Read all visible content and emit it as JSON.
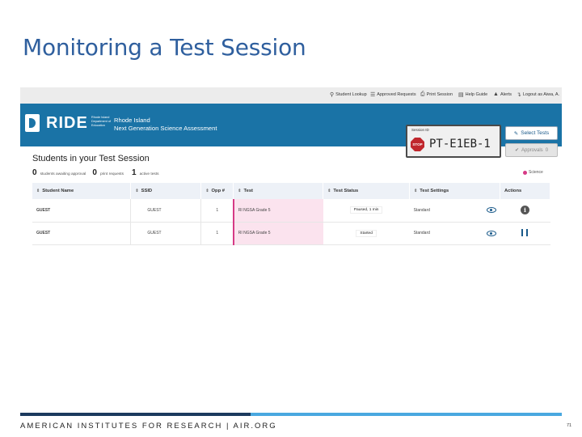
{
  "slide": {
    "title": "Monitoring a Test Session",
    "footer": "AMERICAN INSTITUTES FOR RESEARCH | AIR.ORG",
    "page_number": "71"
  },
  "toolbar": {
    "items": [
      {
        "label": "Student Lookup",
        "icon": "search-icon"
      },
      {
        "label": "Approved Requests",
        "icon": "checklist-icon"
      },
      {
        "label": "Print Session",
        "icon": "print-icon"
      },
      {
        "label": "Help Guide",
        "icon": "book-icon"
      },
      {
        "label": "Alerts",
        "icon": "alert-icon"
      },
      {
        "label": "Logout as Aiwa, A.",
        "icon": "logout-icon"
      }
    ]
  },
  "banner": {
    "logo_text": "RIDE",
    "logo_subtext": "Rhode Island Department of Education",
    "assessment_title_line1": "Rhode Island",
    "assessment_title_line2": "Next Generation Science Assessment",
    "session_label": "Session ID",
    "stop_label": "STOP",
    "session_id": "PT-E1EB-1",
    "select_tests_label": "Select Tests",
    "approvals_label": "Approvals",
    "approvals_count": "0",
    "bg_color": "#1a73a6"
  },
  "students": {
    "heading": "Students in your Test Session",
    "awaiting_count": "0",
    "awaiting_label": "students awaiting approval",
    "print_count": "0",
    "print_label": "print requests",
    "active_count": "1",
    "active_label": "active tests",
    "legend_label": "Science"
  },
  "table": {
    "headers": [
      "Student Name",
      "SSID",
      "Opp #",
      "Test",
      "Test Status",
      "Test Settings",
      "Actions"
    ],
    "rows": [
      {
        "name": "GUEST",
        "ssid": "GUEST",
        "opp": "1",
        "test": "RI NGSA Grade 5",
        "status": "Paused, 1 min",
        "settings": "Standard",
        "action": "info-icon"
      },
      {
        "name": "GUEST",
        "ssid": "GUEST",
        "opp": "1",
        "test": "RI NGSA Grade 5",
        "status": "Started",
        "settings": "Standard",
        "action": "pause-icon"
      }
    ]
  },
  "colors": {
    "title": "#2f5f9e",
    "test_highlight": "#fbe3ee",
    "science_accent": "#d63a86",
    "footer_dark": "#1c3a5e",
    "footer_light": "#49a8e0"
  }
}
